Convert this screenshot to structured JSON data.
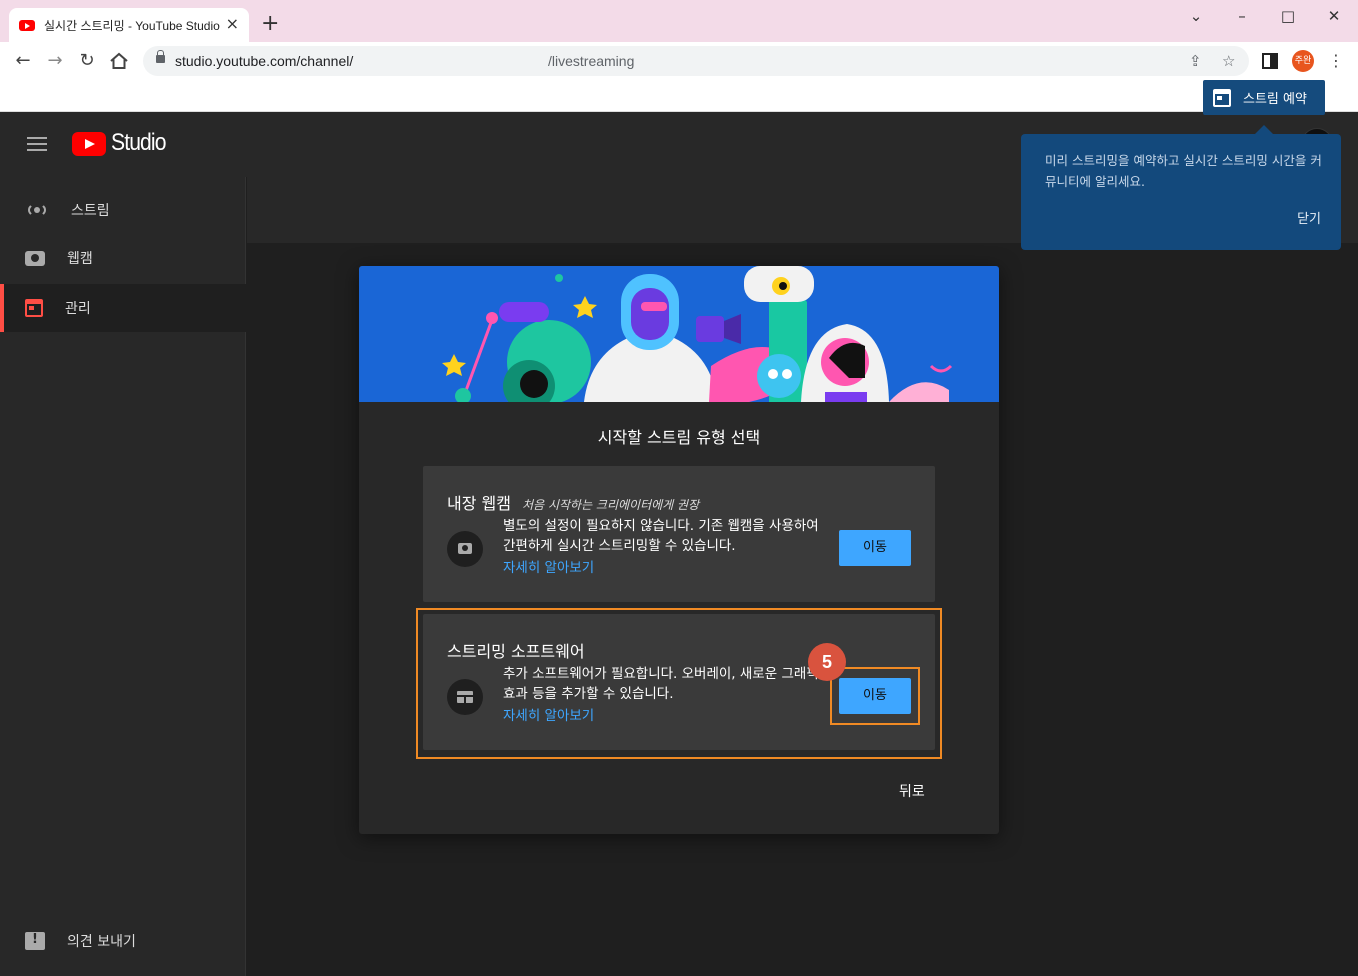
{
  "browser": {
    "tab_title": "실시간 스트리밍 - YouTube Studio",
    "url_main": "studio.youtube.com/channel/",
    "url_tail": "/livestreaming",
    "profile_label": "주완",
    "icons": [
      "back-icon",
      "forward-icon",
      "reload-icon",
      "home-icon",
      "lock-icon",
      "share-icon",
      "star-icon",
      "sidepanel-icon",
      "menu-icon"
    ]
  },
  "app": {
    "logo_text": "Studio",
    "sidebar": {
      "items": [
        {
          "label": "스트림",
          "icon": "live-stream-icon"
        },
        {
          "label": "웹캠",
          "icon": "camera-icon"
        },
        {
          "label": "관리",
          "icon": "calendar-icon",
          "active": true
        }
      ],
      "feedback_label": "의견 보내기"
    },
    "schedule_button": "스트림 예약",
    "tooltip": {
      "message": "미리 스트리밍을 예약하고 실시간 스트리밍 시간을 커뮤니티에 알리세요.",
      "close": "닫기"
    }
  },
  "modal": {
    "title": "시작할 스트림 유형 선택",
    "cards": [
      {
        "title": "내장 웹캠",
        "subtitle": "처음 시작하는 크리에이터에게 권장",
        "description": "별도의 설정이 필요하지 않습니다. 기존 웹캠을 사용하여 간편하게 실시간 스트리밍할 수 있습니다.",
        "link": "자세히 알아보기",
        "button": "이동"
      },
      {
        "title": "스트리밍 소프트웨어",
        "description": "추가 소프트웨어가 필요합니다. 오버레이, 새로운 그래픽 효과 등을 추가할 수 있습니다.",
        "link": "자세히 알아보기",
        "button": "이동"
      }
    ],
    "back": "뒤로"
  },
  "annotation": {
    "step": "5",
    "color": "#f08a24"
  },
  "colors": {
    "accent_blue": "#3ea6ff",
    "active_red": "#ff4e45",
    "banner_blue": "#1a66d6"
  }
}
